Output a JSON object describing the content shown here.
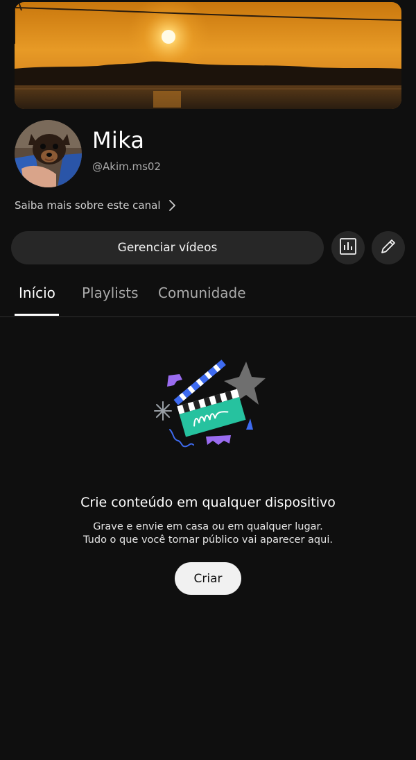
{
  "channel": {
    "name": "Mika",
    "handle": "@Akim.ms02",
    "about_link": "Saiba mais sobre este canal"
  },
  "actions": {
    "manage_videos": "Gerenciar vídeos",
    "analytics_icon": "bar-chart-icon",
    "edit_icon": "pencil-icon"
  },
  "tabs": [
    {
      "label": "Início",
      "active": true
    },
    {
      "label": "Playlists",
      "active": false
    },
    {
      "label": "Comunidade",
      "active": false
    }
  ],
  "empty_state": {
    "title": "Crie conteúdo em qualquer dispositivo",
    "line1": "Grave e envie em casa ou em qualquer lugar.",
    "line2": "Tudo o que você tornar público vai aparecer aqui.",
    "create_button": "Criar"
  },
  "colors": {
    "background": "#0f0f0f",
    "button_dark": "#272727",
    "button_light": "#f1f1f1",
    "accent_teal": "#26c29f",
    "accent_blue": "#3e6bf0",
    "accent_purple": "#9a6cf0"
  }
}
